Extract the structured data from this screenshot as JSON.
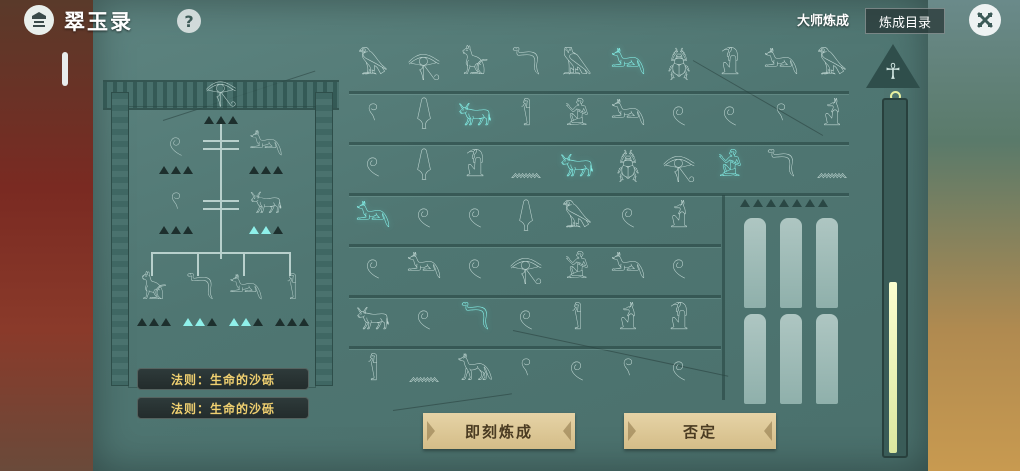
{
  "header": {
    "title": "翠玉录",
    "help_label": "?",
    "tab_master": "大师炼成",
    "tab_catalog": "炼成目录"
  },
  "recipe": {
    "laws": [
      "法则：生命的沙砾",
      "法则：生命的沙砾"
    ],
    "glyphs": {
      "top": "𓂀",
      "left1": "𓏲",
      "right1": "𓃢",
      "left2": "𓍢",
      "right2": "𓃒",
      "b1": "𓃠",
      "b2": "𓆓",
      "b3": "𓃢",
      "b4": "𓀾"
    }
  },
  "grid": {
    "rows": [
      [
        "𓅃",
        "𓂀",
        "𓃠",
        "𓆓",
        "𓅓",
        "𓃢",
        "𓆣",
        "𓁟",
        "𓃢",
        "𓅃"
      ],
      [
        "𓍢",
        "𓆭",
        "𓃒",
        "𓀾",
        "𓀀",
        "𓃢",
        "𓏲",
        "𓏲",
        "𓍢",
        "𓁢"
      ],
      [
        "𓏲",
        "𓆭",
        "𓁟",
        "𓈖",
        "𓃒",
        "𓆣",
        "𓂀",
        "𓀀",
        "𓆓",
        "𓈖"
      ],
      [
        "𓃢",
        "𓏲",
        "𓏲",
        "𓆭",
        "𓅃",
        "𓏲",
        "𓁢"
      ],
      [
        "𓏲",
        "𓃢",
        "𓏲",
        "𓂀",
        "𓀀",
        "𓃢",
        "𓏲"
      ],
      [
        "𓃒",
        "𓏲",
        "𓆓",
        "𓏲",
        "𓀾",
        "𓁢",
        "𓁟"
      ],
      [
        "𓀾",
        "𓈖",
        "𓃥",
        "𓍢",
        "𓏲",
        "𓍢",
        "𓏲"
      ]
    ],
    "highlights": [
      "0-5",
      "1-2",
      "2-4",
      "2-7",
      "3-0",
      "5-2"
    ]
  },
  "buttons": {
    "confirm": "即刻炼成",
    "deny": "否定"
  },
  "gauge": {
    "fill_fraction": 0.48,
    "ankh": "☥"
  }
}
